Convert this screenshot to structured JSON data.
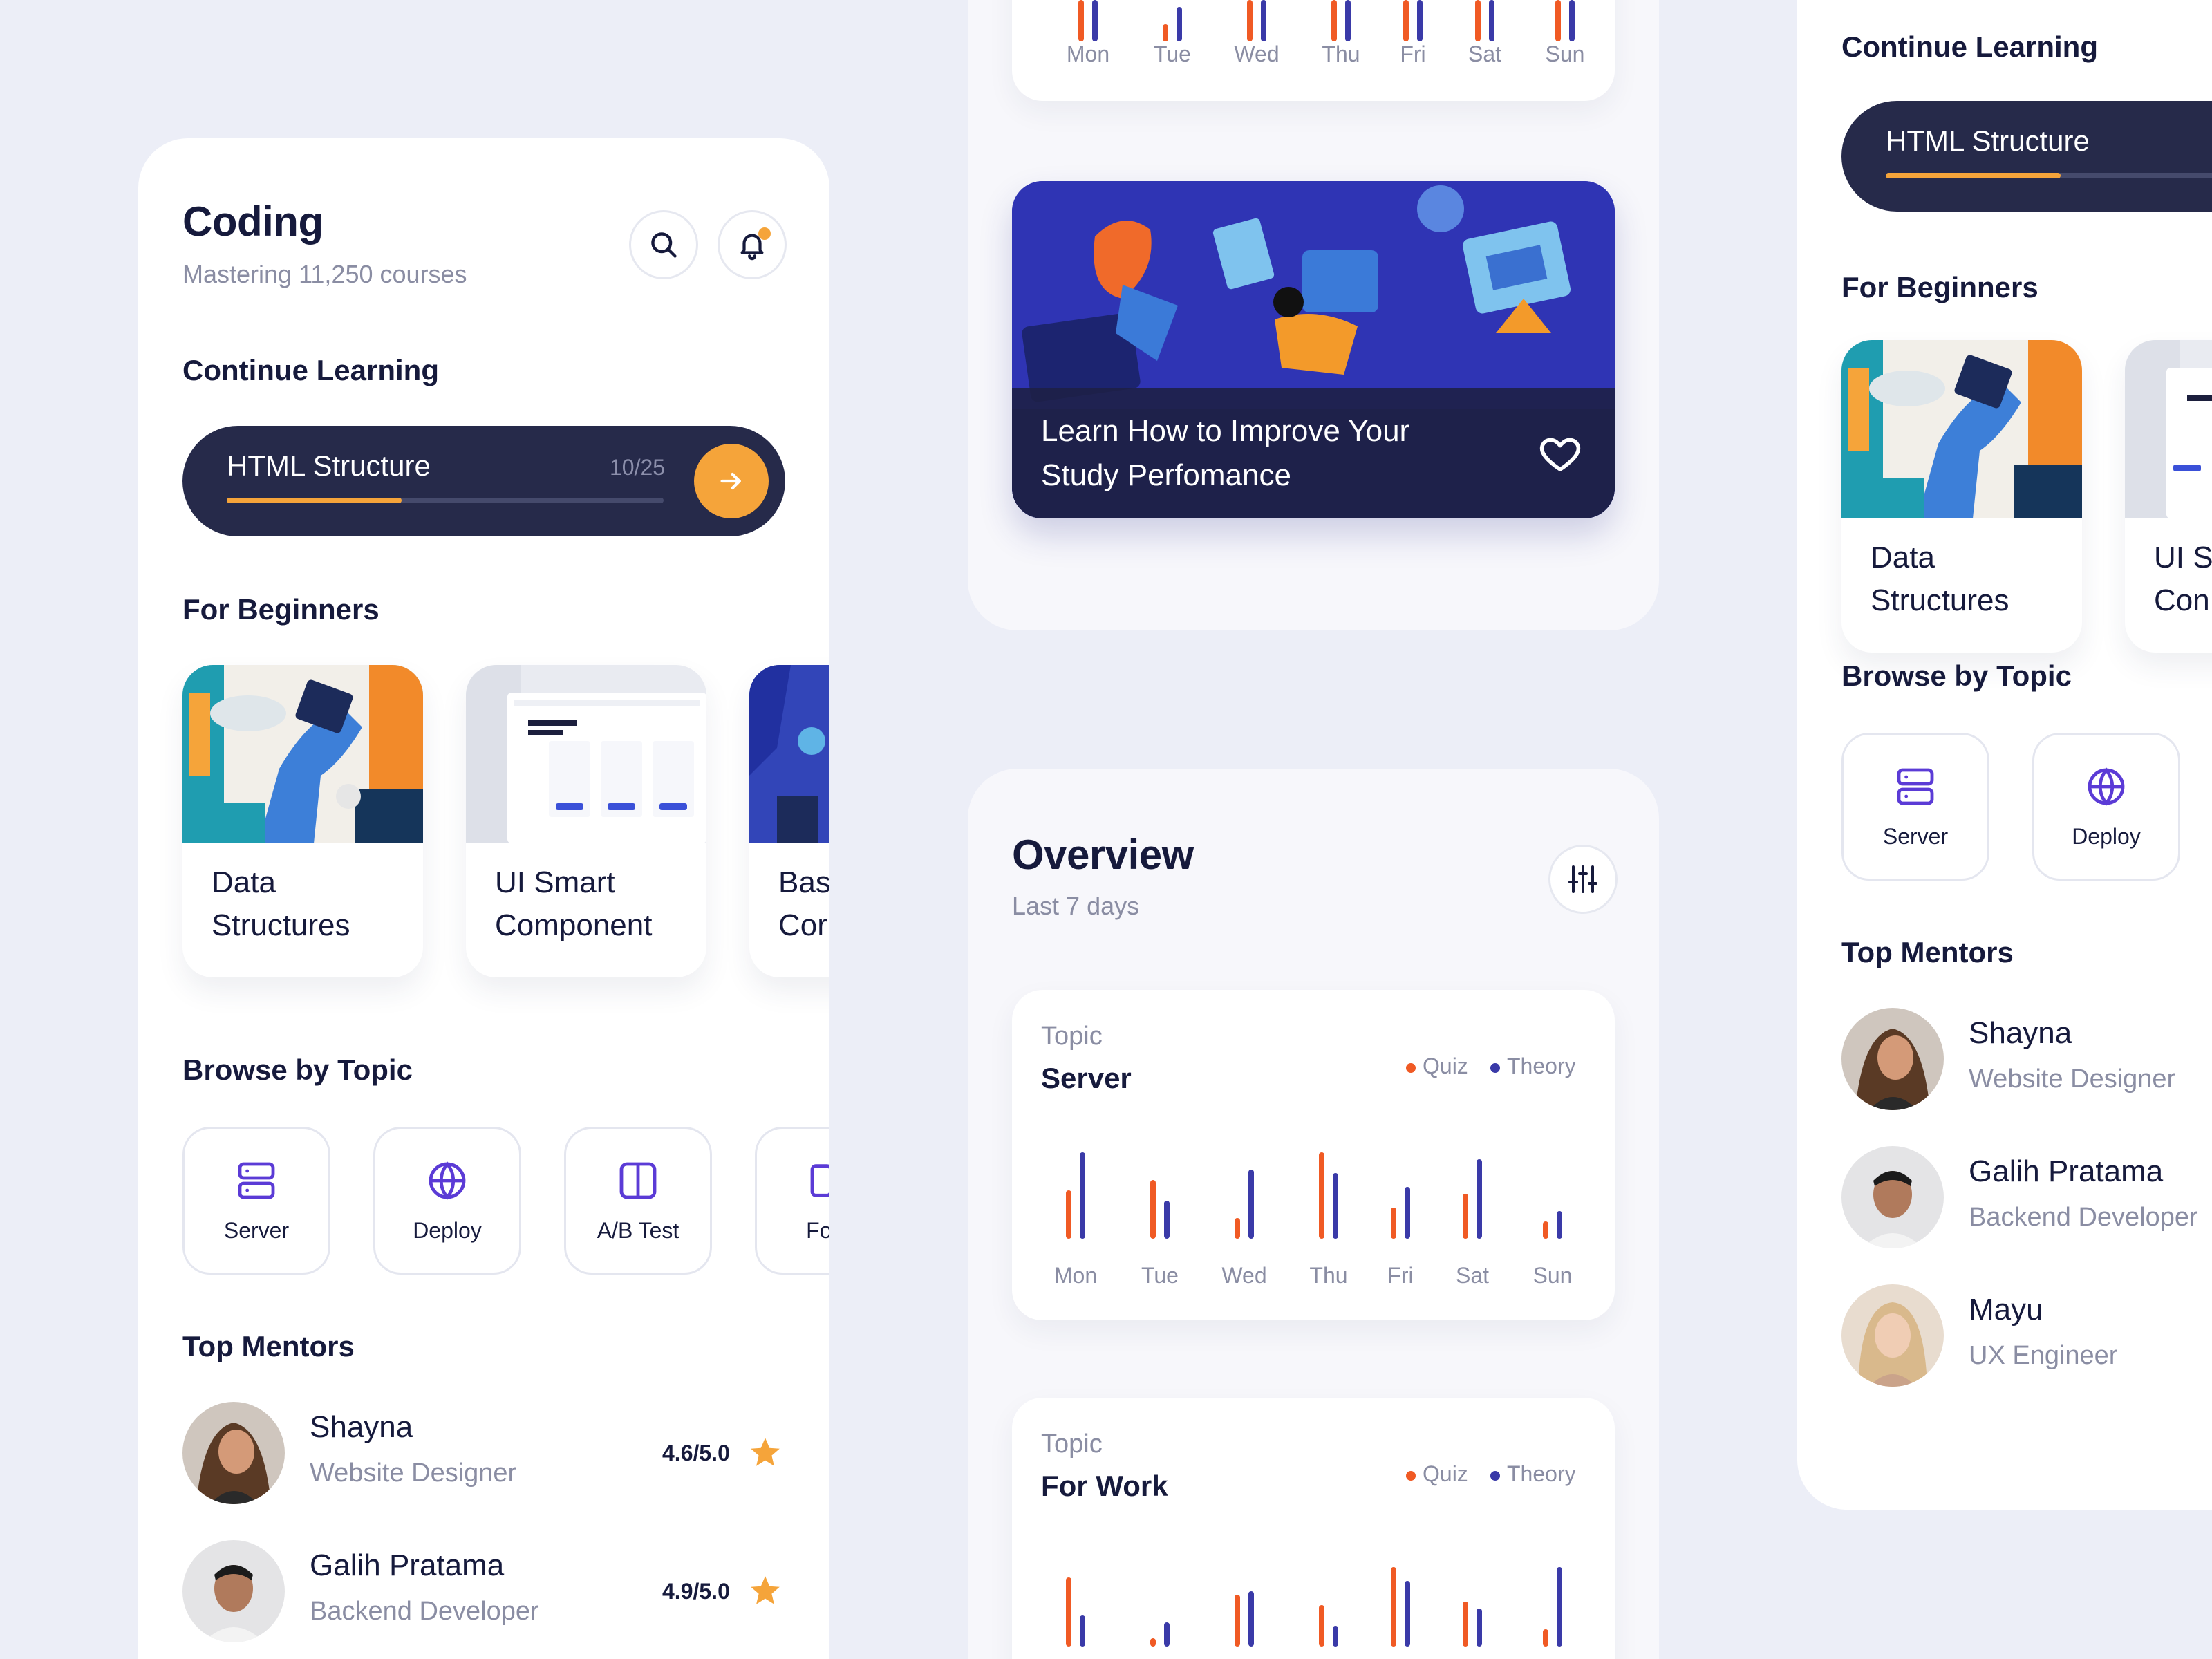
{
  "colors": {
    "background": "#eceef7",
    "navy": "#262a4a",
    "accent_orange": "#f5a43a",
    "quiz": "#f05a24",
    "theory": "#3a3aa8",
    "icon_purple": "#5b3bd6"
  },
  "left": {
    "header": {
      "title": "Coding",
      "subtitle": "Mastering 11,250 courses"
    },
    "header_icons": [
      "search-icon",
      "bell-icon"
    ],
    "continue": {
      "heading": "Continue Learning",
      "course": "HTML Structure",
      "count": "10/25",
      "progress": 0.4
    },
    "beginners": {
      "heading": "For Beginners",
      "cards": [
        {
          "line1": "Data",
          "line2": "Structures"
        },
        {
          "line1": "UI Smart",
          "line2": "Component"
        },
        {
          "line1": "Bas",
          "line2": "Cor"
        }
      ]
    },
    "browse": {
      "heading": "Browse by Topic",
      "topics": [
        {
          "label": "Server",
          "icon": "server-icon"
        },
        {
          "label": "Deploy",
          "icon": "globe-icon"
        },
        {
          "label": "A/B Test",
          "icon": "columns-icon"
        },
        {
          "label": "For \\",
          "icon": "devices-icon"
        }
      ]
    },
    "mentors": {
      "heading": "Top Mentors",
      "list": [
        {
          "name": "Shayna",
          "role": "Website Designer",
          "rating": "4.6/5.0"
        },
        {
          "name": "Galih Pratama",
          "role": "Backend Developer",
          "rating": "4.9/5.0"
        }
      ]
    }
  },
  "middle": {
    "top_days": [
      "Mon",
      "Tue",
      "Wed",
      "Thu",
      "Fri",
      "Sat",
      "Sun"
    ],
    "promo": {
      "line1": "Learn How to Improve Your",
      "line2": "Study Perfomance"
    },
    "overview": {
      "title": "Overview",
      "subtitle": "Last 7 days"
    },
    "legend": {
      "quiz": "Quiz",
      "theory": "Theory"
    },
    "chart_data": [
      {
        "type": "bar",
        "topic_label": "Topic",
        "title": "Server",
        "categories": [
          "Mon",
          "Tue",
          "Wed",
          "Thu",
          "Fri",
          "Sat",
          "Sun"
        ],
        "series": [
          {
            "name": "Quiz",
            "values": [
              70,
              85,
              30,
              125,
              45,
              65,
              25
            ]
          },
          {
            "name": "Theory",
            "values": [
              125,
              55,
              100,
              95,
              75,
              115,
              40
            ]
          }
        ],
        "ylim": [
          0,
          130
        ]
      },
      {
        "type": "bar",
        "topic_label": "Topic",
        "title": "For Work",
        "categories": [
          "Mon",
          "Tue",
          "Wed",
          "Thu",
          "Fri",
          "Sat",
          "Sun"
        ],
        "series": [
          {
            "name": "Quiz",
            "values": [
              100,
              12,
              75,
              60,
              115,
              65,
              25
            ]
          },
          {
            "name": "Theory",
            "values": [
              45,
              35,
              80,
              30,
              95,
              55,
              115
            ]
          }
        ],
        "ylim": [
          0,
          130
        ]
      }
    ]
  },
  "right": {
    "continue": {
      "heading": "Continue Learning",
      "course": "HTML Structure",
      "progress": 0.4
    },
    "beginners": {
      "heading": "For Beginners",
      "cards": [
        {
          "line1": "Data",
          "line2": "Structures"
        },
        {
          "line1": "UI Sr",
          "line2": "Con"
        }
      ]
    },
    "browse": {
      "heading": "Browse by Topic",
      "topics": [
        {
          "label": "Server",
          "icon": "server-icon"
        },
        {
          "label": "Deploy",
          "icon": "globe-icon"
        }
      ]
    },
    "mentors": {
      "heading": "Top Mentors",
      "list": [
        {
          "name": "Shayna",
          "role": "Website Designer"
        },
        {
          "name": "Galih Pratama",
          "role": "Backend Developer"
        },
        {
          "name": "Mayu",
          "role": "UX Engineer"
        }
      ]
    }
  }
}
